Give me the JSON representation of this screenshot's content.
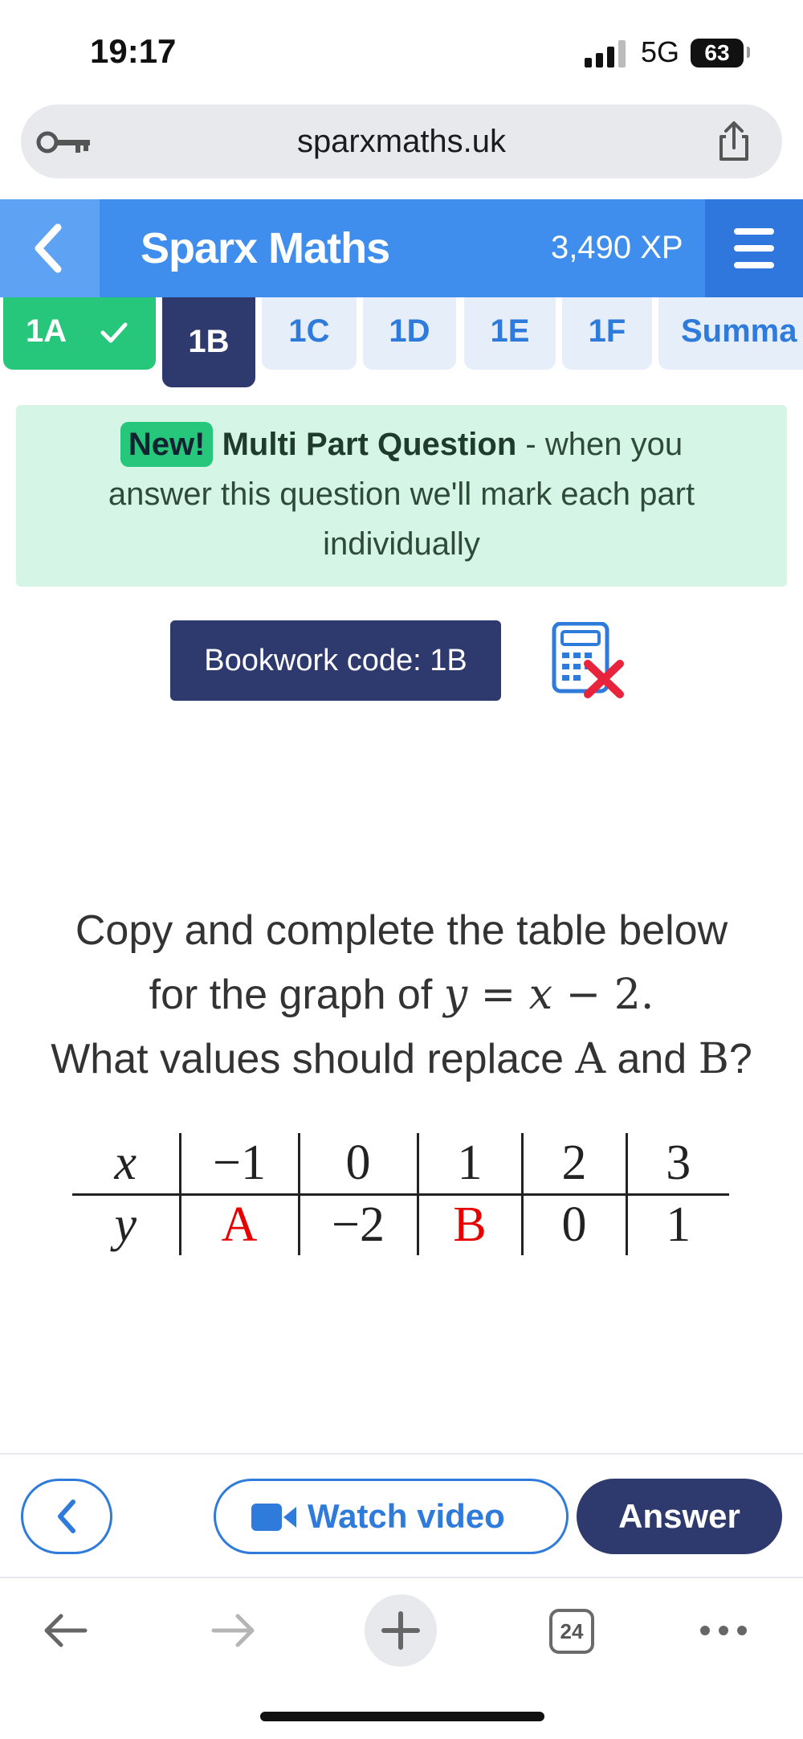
{
  "status_bar": {
    "time": "19:17",
    "network": "5G",
    "battery": "63"
  },
  "browser": {
    "url": "sparxmaths.uk",
    "tab_count": "24"
  },
  "header": {
    "brand": "Sparx Maths",
    "xp": "3,490 XP"
  },
  "tabs": [
    {
      "label": "1A",
      "state": "done"
    },
    {
      "label": "1B",
      "state": "active"
    },
    {
      "label": "1C",
      "state": "normal"
    },
    {
      "label": "1D",
      "state": "normal"
    },
    {
      "label": "1E",
      "state": "normal"
    },
    {
      "label": "1F",
      "state": "normal"
    },
    {
      "label": "Summa",
      "state": "normal"
    }
  ],
  "notice": {
    "badge": "New!",
    "title": "Multi Part Question",
    "text_line1": " - when you",
    "text_rest": "answer this question we'll mark each part individually"
  },
  "bookwork": {
    "label": "Bookwork code: 1B"
  },
  "question": {
    "line1": "Copy and complete the table below",
    "line2_prefix": "for the graph of ",
    "equation_y": "y",
    "equation_eq": " = ",
    "equation_x": "x",
    "equation_rest": " − 2.",
    "line3_prefix": "What values should replace ",
    "var_a": "A",
    "and": " and ",
    "var_b": "B",
    "qmark": "?"
  },
  "table": {
    "x_label": "x",
    "y_label": "y",
    "x_values": [
      "−1",
      "0",
      "1",
      "2",
      "3"
    ],
    "y_values": [
      "A",
      "−2",
      "B",
      "0",
      "1"
    ],
    "unknown_color": "#e60000"
  },
  "actions": {
    "watch_video": "Watch video",
    "answer": "Answer"
  },
  "colors": {
    "brand_blue": "#3f8ded",
    "navy": "#2e3a6e",
    "green": "#27c77b",
    "link_blue": "#2f7bdb"
  }
}
